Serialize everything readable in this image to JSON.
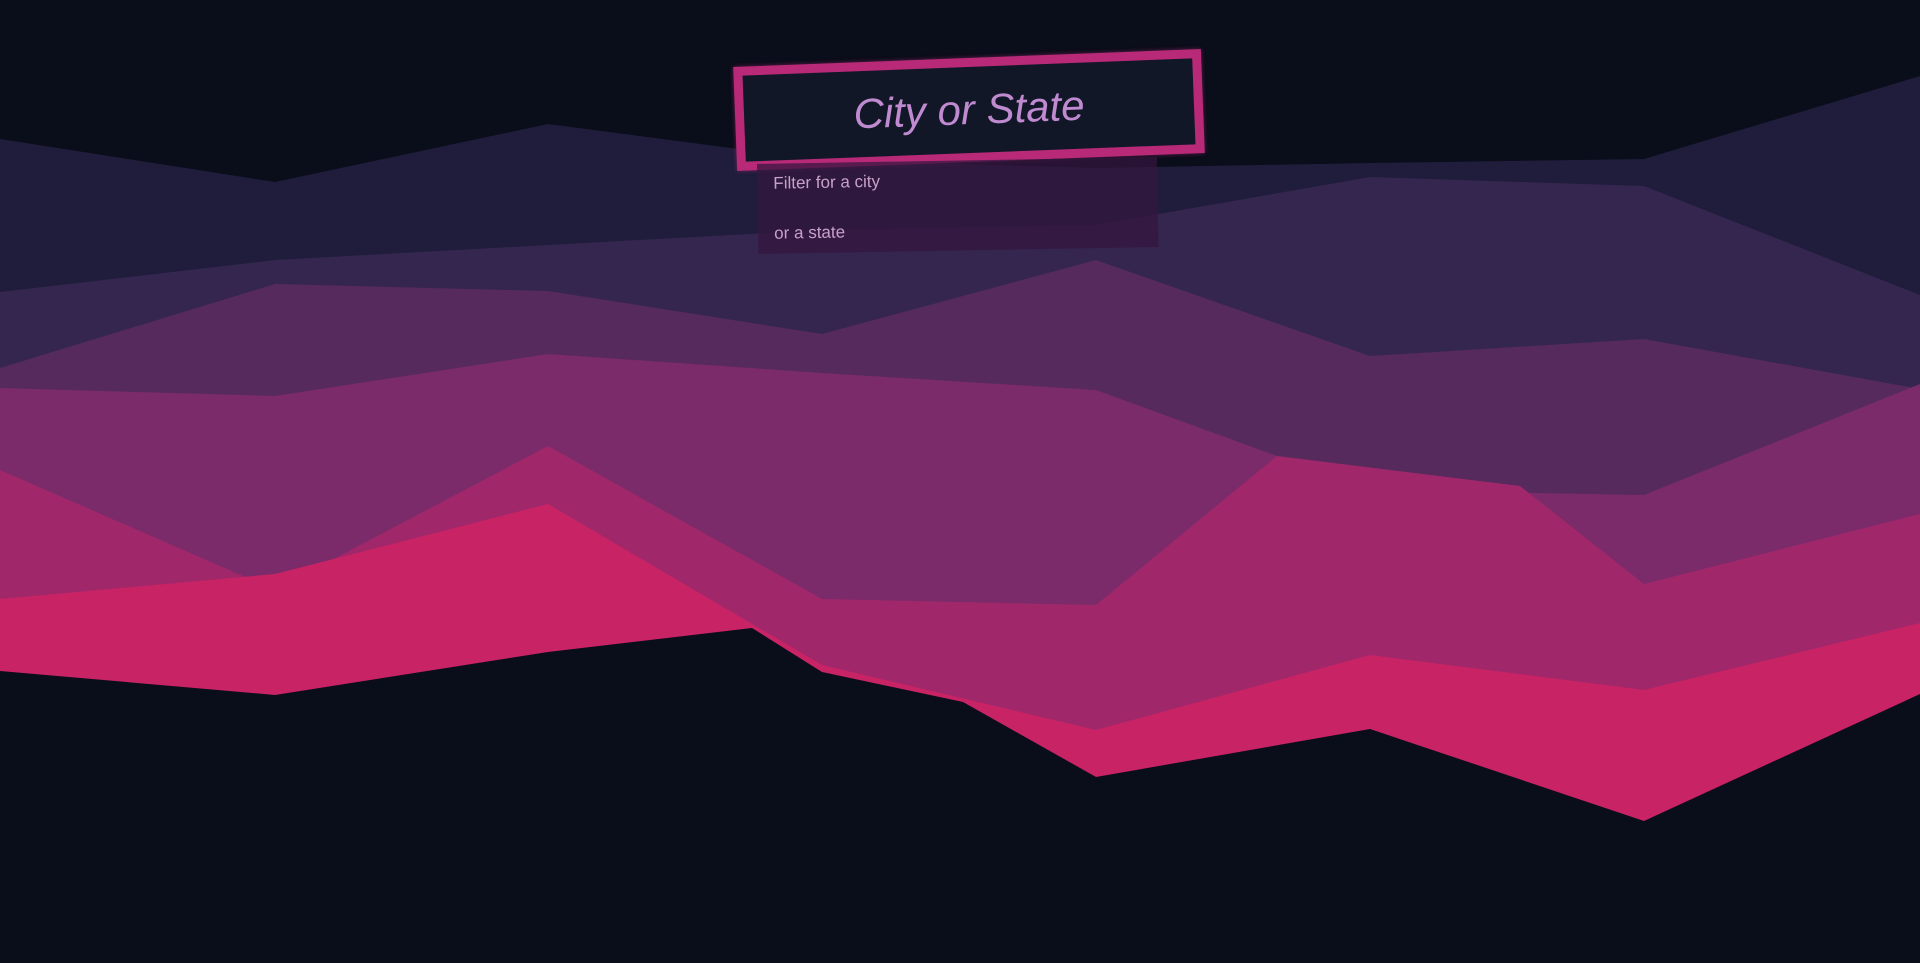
{
  "search": {
    "placeholder": "City or State",
    "value": ""
  },
  "suggestions": [
    "Filter for a city",
    "or a state"
  ],
  "colors": {
    "background": "#0a0d1a",
    "input_border": "#b82a78",
    "input_text": "#c08ad0",
    "wave_1": "#1f1d3b",
    "wave_2": "#35264f",
    "wave_3": "#562a5d",
    "wave_4": "#7b2b69",
    "wave_5": "#a1276b",
    "wave_6": "#c82365"
  }
}
